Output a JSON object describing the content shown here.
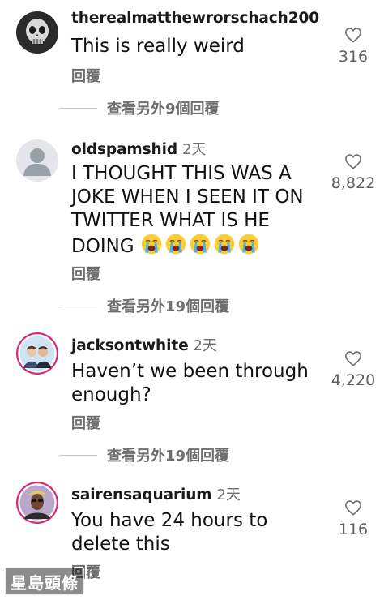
{
  "comments": [
    {
      "username": "therealmatthewrorschach200",
      "time": "",
      "text": "This is really weird",
      "reply_label": "回覆",
      "likes": "316",
      "avatar": "skull-avatar"
    },
    {
      "username": "oldspamshid",
      "time": "2天",
      "text": "I THOUGHT THIS WAS A JOKE WHEN I SEEN IT ON TWITTER WHAT IS HE DOING",
      "emoji_count": 5,
      "emoji_name": "loudly-crying-face-emoji",
      "reply_label": "回覆",
      "likes": "8,822",
      "avatar": "default-avatar"
    },
    {
      "username": "jacksontwhite",
      "time": "2天",
      "text": "Haven’t we been through enough?",
      "reply_label": "回覆",
      "likes": "4,220",
      "avatar": "couple-photo-avatar"
    },
    {
      "username": "sairensaquarium",
      "time": "2天",
      "text": "You have 24 hours to delete this",
      "reply_label": "回覆",
      "likes": "116",
      "avatar": "portrait-avatar"
    }
  ],
  "view_more": [
    "查看另外9個回覆",
    "查看另外19個回覆",
    "查看另外19個回覆"
  ],
  "watermark": "星島頭條",
  "colors": {
    "text": "#111111",
    "secondary": "#6f6f6f",
    "story_ring": "#d62976"
  }
}
